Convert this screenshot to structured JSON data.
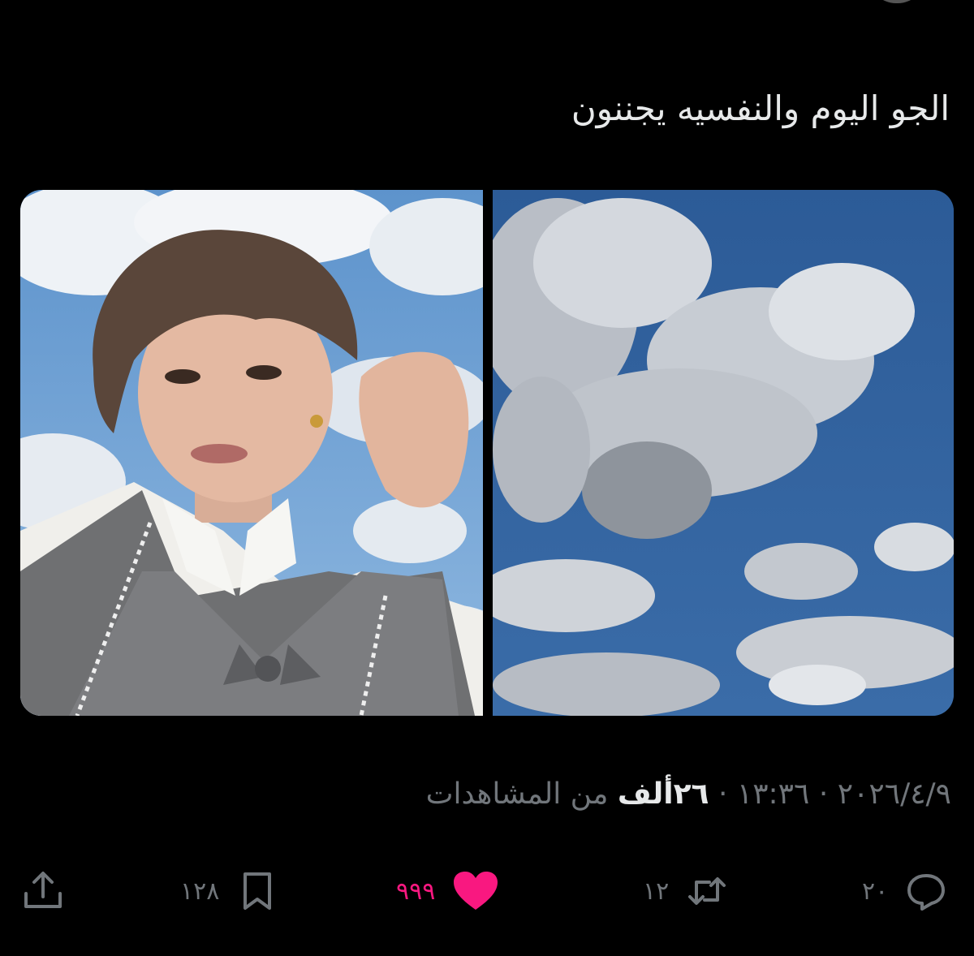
{
  "tweet": {
    "text": "الجو اليوم والنفسيه يجننون"
  },
  "media": {
    "left_image": "portrait-photo-sky-background",
    "right_image": "cloudy-sky-photo"
  },
  "meta": {
    "date": "٢٠٢٦/٤/٩",
    "time": "١٣:٣٦",
    "separator": "·",
    "views_count": "٢٦ألف",
    "views_label": "من المشاهدات"
  },
  "actions": {
    "replies": "٢٠",
    "retweets": "١٢",
    "likes": "٩٩٩",
    "bookmarks": "١٢٨"
  },
  "colors": {
    "background": "#000000",
    "text": "#e7e9ea",
    "muted": "#71767b",
    "like": "#f91880"
  }
}
